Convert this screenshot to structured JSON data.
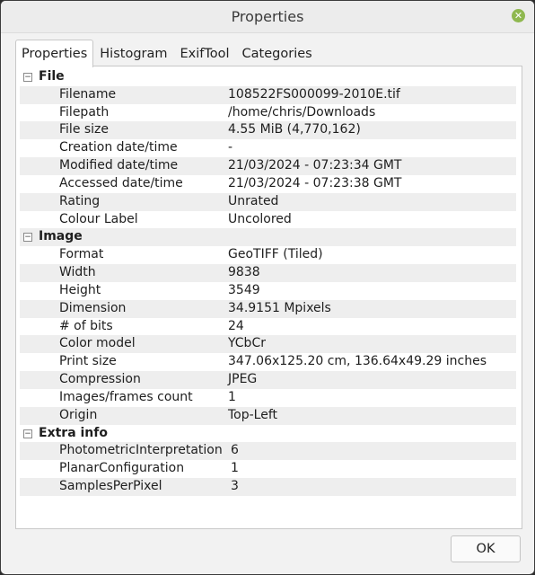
{
  "window": {
    "title": "Properties",
    "close_glyph": "✕"
  },
  "tabs": [
    {
      "label": "Properties",
      "active": true
    },
    {
      "label": "Histogram"
    },
    {
      "label": "ExifTool"
    },
    {
      "label": "Categories"
    }
  ],
  "groups": {
    "file": {
      "label": "File",
      "toggle": "−",
      "rows": [
        {
          "name": "Filename",
          "value": "108522FS000099-2010E.tif"
        },
        {
          "name": "Filepath",
          "value": "/home/chris/Downloads"
        },
        {
          "name": "File size",
          "value": "4.55 MiB (4,770,162)"
        },
        {
          "name": "Creation date/time",
          "value": "-"
        },
        {
          "name": "Modified date/time",
          "value": "21/03/2024 - 07:23:34 GMT"
        },
        {
          "name": "Accessed date/time",
          "value": "21/03/2024 - 07:23:38 GMT"
        },
        {
          "name": "Rating",
          "value": "Unrated"
        },
        {
          "name": "Colour Label",
          "value": "Uncolored"
        }
      ]
    },
    "image": {
      "label": "Image",
      "toggle": "−",
      "rows": [
        {
          "name": "Format",
          "value": "GeoTIFF (Tiled)"
        },
        {
          "name": "Width",
          "value": "9838"
        },
        {
          "name": "Height",
          "value": "3549"
        },
        {
          "name": "Dimension",
          "value": "34.9151 Mpixels"
        },
        {
          "name": "# of bits",
          "value": "24"
        },
        {
          "name": "Color model",
          "value": "YCbCr"
        },
        {
          "name": "Print size",
          "value": "347.06x125.20 cm, 136.64x49.29 inches"
        },
        {
          "name": "Compression",
          "value": "JPEG"
        },
        {
          "name": "Images/frames count",
          "value": "1"
        },
        {
          "name": "Origin",
          "value": "Top-Left"
        }
      ]
    },
    "extra": {
      "label": "Extra info",
      "toggle": "−",
      "rows": [
        {
          "name": "PhotometricInterpretation",
          "value": "6"
        },
        {
          "name": "PlanarConfiguration",
          "value": "1"
        },
        {
          "name": "SamplesPerPixel",
          "value": "3"
        }
      ]
    }
  },
  "buttons": {
    "ok": "OK"
  },
  "colors": {
    "close_accent": "#8fb84f",
    "row_alt": "#eeeeee"
  }
}
